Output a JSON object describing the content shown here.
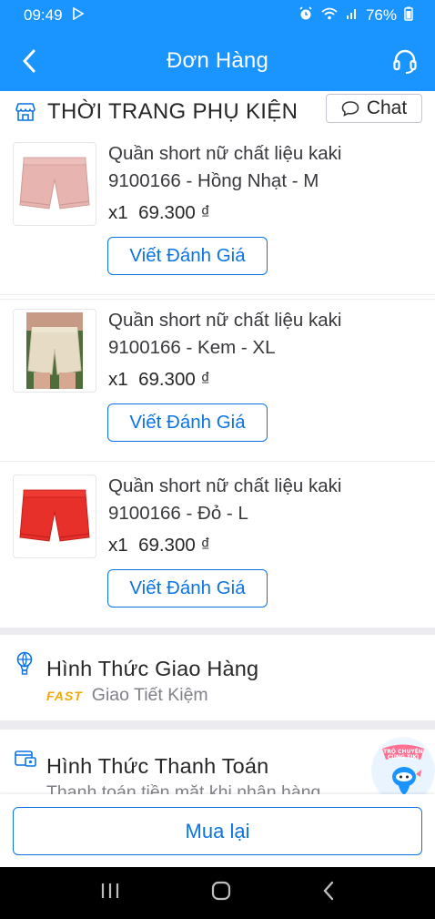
{
  "status_bar": {
    "time": "09:49",
    "battery": "76%"
  },
  "header": {
    "title": "Đơn Hàng"
  },
  "shop": {
    "name": "THỜI TRANG PHỤ KIỆN",
    "chat_label": "Chat"
  },
  "products": [
    {
      "name": "Quần short nữ chất liệu kaki 9100166 - Hồng Nhạt - M",
      "quantity": "x1",
      "price": "69.300 ₫",
      "review_label": "Viết Đánh Giá",
      "color": "#e8b4b0"
    },
    {
      "name": "Quần short nữ chất liệu kaki 9100166 - Kem - XL",
      "quantity": "x1",
      "price": "69.300 ₫",
      "review_label": "Viết Đánh Giá",
      "color": "#e6dcc6"
    },
    {
      "name": "Quần short nữ chất liệu kaki 9100166 - Đỏ - L",
      "quantity": "x1",
      "price": "69.300 ₫",
      "review_label": "Viết Đánh Giá",
      "color": "#e8302a"
    }
  ],
  "shipping": {
    "title": "Hình Thức Giao Hàng",
    "badge": "FAST",
    "method": "Giao Tiết Kiệm"
  },
  "payment": {
    "title": "Hình Thức Thanh Toán",
    "method": "Thanh toán tiền mặt khi nhận hàng"
  },
  "chat_float": {
    "label": "TRÒ CHUYỆN CÙNG TIKI"
  },
  "bottom": {
    "rebuy_label": "Mua lại"
  },
  "colors": {
    "brand": "#1a94ff",
    "link": "#0b74e5",
    "fast_badge": "#f5a800"
  }
}
